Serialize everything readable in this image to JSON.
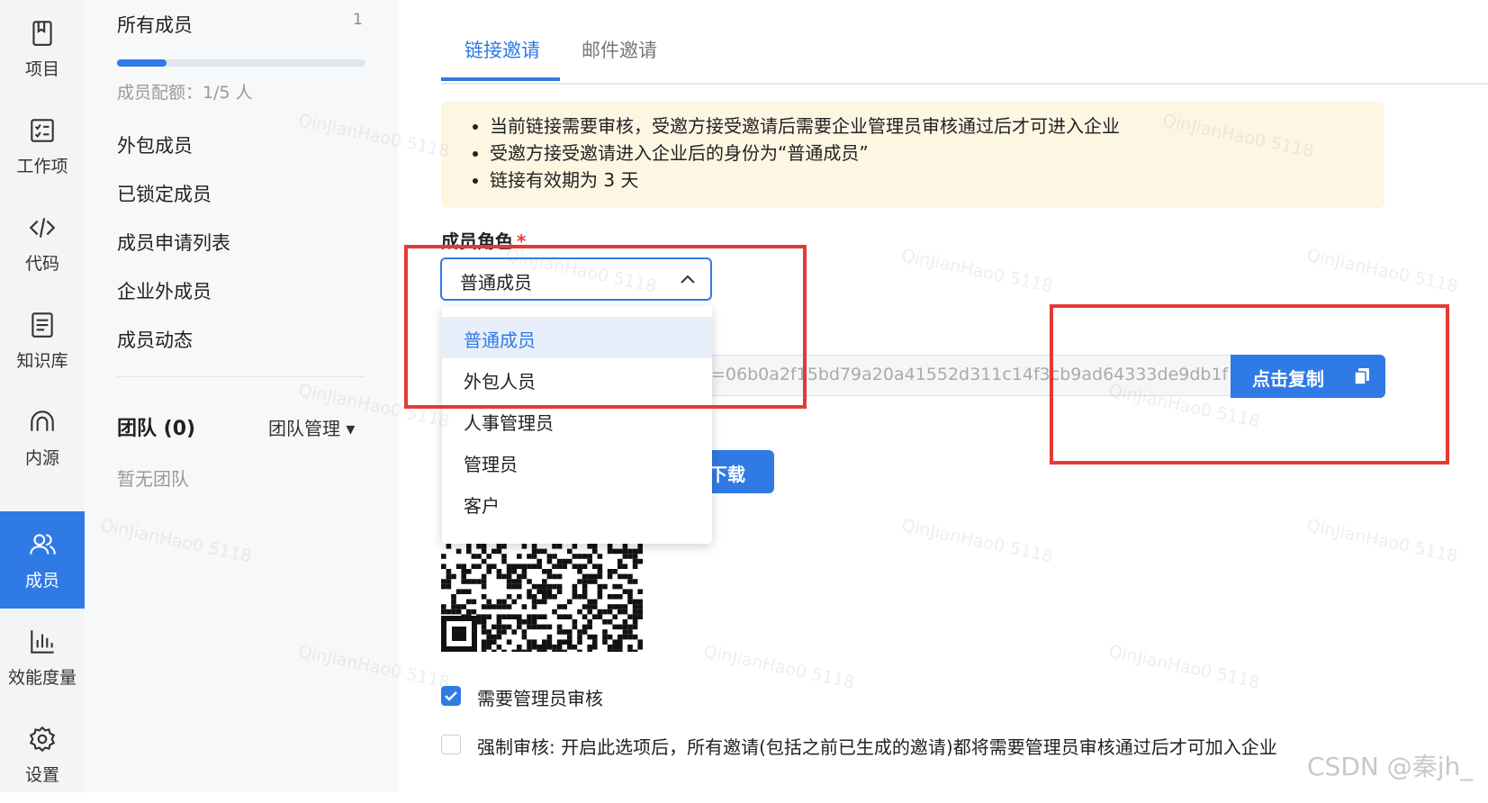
{
  "sidebar": {
    "items": [
      {
        "label": "项目",
        "icon": "book-icon"
      },
      {
        "label": "工作项",
        "icon": "checklist-icon"
      },
      {
        "label": "代码",
        "icon": "code-icon"
      },
      {
        "label": "知识库",
        "icon": "document-icon"
      },
      {
        "label": "内源",
        "icon": "inner-source-icon"
      },
      {
        "label": "成员",
        "icon": "people-icon",
        "active": true
      },
      {
        "label": "效能度量",
        "icon": "bar-chart-icon"
      },
      {
        "label": "设置",
        "icon": "gear-icon"
      }
    ]
  },
  "panel": {
    "all_members": "所有成员",
    "all_members_count": "1",
    "quota_used_fraction": 0.2,
    "quota_label": "成员配额：1/5 人",
    "outsourced": "外包成员",
    "locked": "已锁定成员",
    "applications": "成员申请列表",
    "external": "企业外成员",
    "activity": "成员动态",
    "team_title": "团队 (0)",
    "team_manage": "团队管理 ▾",
    "no_team": "暂无团队"
  },
  "main": {
    "tabs": [
      {
        "label": "链接邀请",
        "active": true
      },
      {
        "label": "邮件邀请",
        "active": false
      }
    ],
    "notice": [
      "当前链接需要审核，受邀方接受邀请后需要企业管理员审核通过后才可进入企业",
      "受邀方接受邀请进入企业后的身份为“普通成员”",
      "链接有效期为 3 天"
    ],
    "role_label": "成员角色",
    "required_mark": "*",
    "role_value": "普通成员",
    "role_options": [
      "普通成员",
      "外包人员",
      "人事管理员",
      "管理员",
      "客户"
    ],
    "link_text": "=06b0a2f15bd79a20a41552d311c14f3cb9ad64333de9db1f",
    "copy_button": "点击复制",
    "download_button": "下载",
    "checkbox_review": "需要管理员审核",
    "checkbox_force": "强制审核: 开启此选项后，所有邀请(包括之前已生成的邀请)都将需要管理员审核通过后才可加入企业",
    "watermark": "QinJianHao0 5118",
    "csdn_mark": "CSDN @秦jh_"
  },
  "colors": {
    "accent": "#2f7ae5",
    "highlight": "#e53935",
    "notice_bg": "#fdf6e3"
  }
}
